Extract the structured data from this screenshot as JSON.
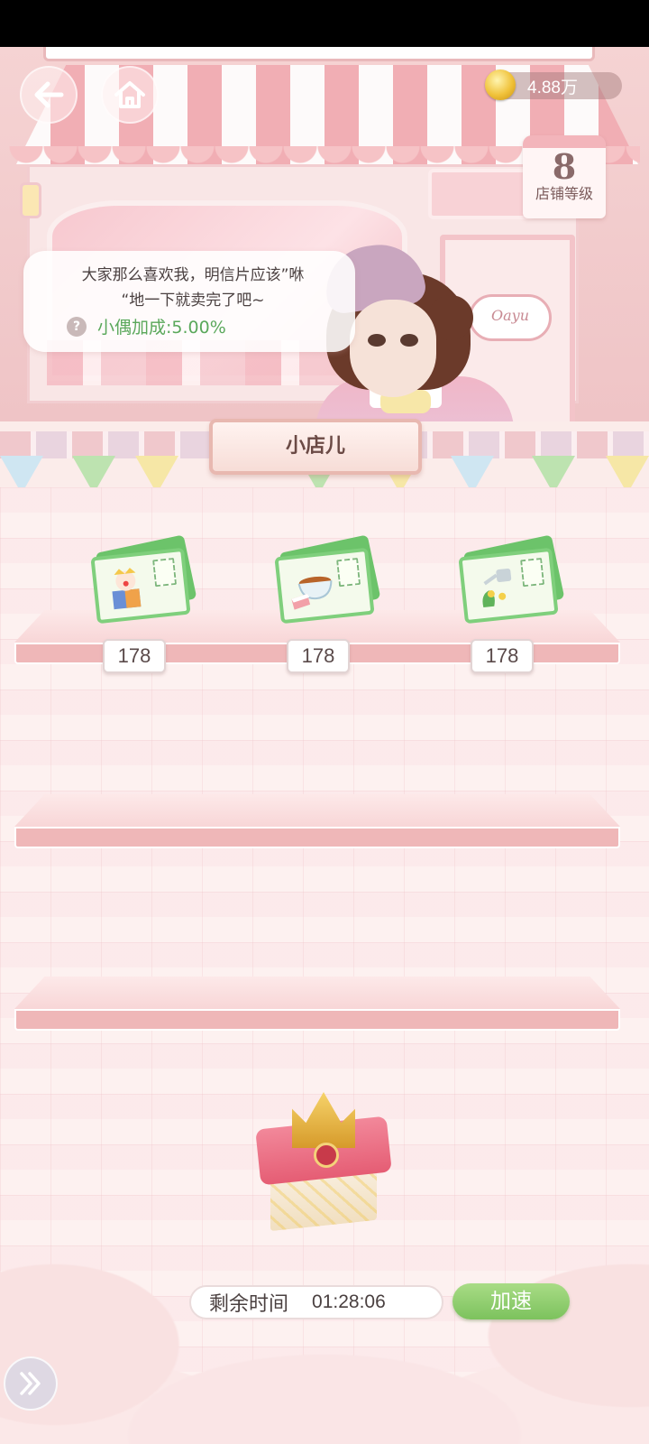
{
  "header": {
    "currency": {
      "icon": "gold-coin-icon",
      "value": "4.88万"
    },
    "shop_level": {
      "value": "8",
      "label": "店铺等级"
    },
    "door_sign": "Oayu"
  },
  "dialog": {
    "line1": "大家那么喜欢我，明信片应该”咻",
    "line2": "“地一下就卖完了吧~",
    "bonus": "小偶加成:5.00%",
    "help_icon": "?"
  },
  "shop": {
    "title": "小店儿",
    "items": [
      {
        "name": "jack-in-the-box-postcard",
        "count": "178"
      },
      {
        "name": "teacup-cake-postcard",
        "count": "178"
      },
      {
        "name": "watering-can-flower-postcard",
        "count": "178"
      }
    ]
  },
  "footer": {
    "remaining_label": "剩余时间",
    "remaining_time": "01:28:06",
    "speed_up_label": "加速"
  },
  "colors": {
    "accent_pink": "#efb7b8",
    "button_green": "#7cc25d",
    "bonus_green": "#5aa85b",
    "coin_gold": "#f0c23a"
  }
}
